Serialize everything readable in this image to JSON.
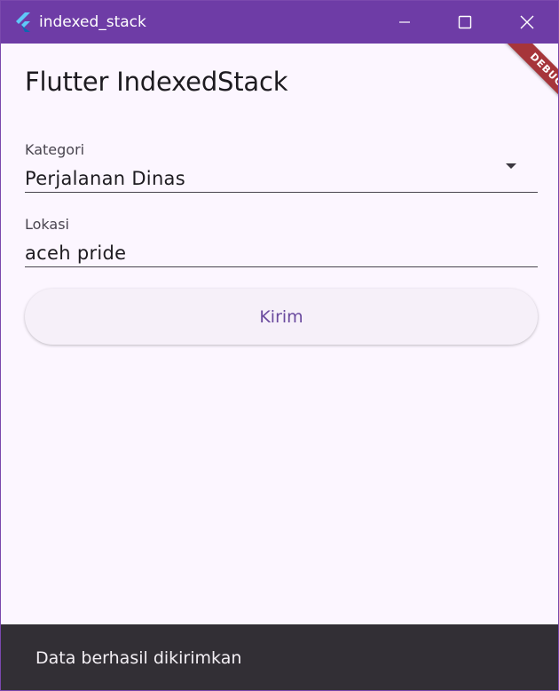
{
  "window": {
    "title": "indexed_stack",
    "icon": "flutter-logo-icon",
    "controls": [
      "minimize-icon",
      "maximize-icon",
      "close-icon"
    ]
  },
  "debug_banner": "DEBUG",
  "page": {
    "title": "Flutter IndexedStack"
  },
  "form": {
    "kategori": {
      "label": "Kategori",
      "value": "Perjalanan Dinas",
      "icon": "dropdown-arrow-icon"
    },
    "lokasi": {
      "label": "Lokasi",
      "value": "aceh pride"
    },
    "submit_label": "Kirim"
  },
  "snackbar": {
    "message": "Data berhasil dikirimkan"
  },
  "colors": {
    "titlebar": "#6e3ca6",
    "background": "#fcf6ff",
    "accent": "#6a4a9e",
    "snackbar": "#322f35",
    "debug_ribbon": "#a6353a"
  }
}
